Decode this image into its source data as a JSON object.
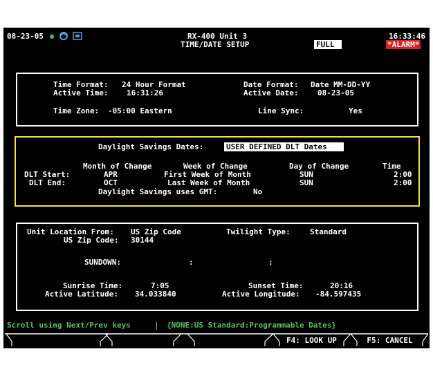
{
  "header": {
    "date": "08-23-05",
    "unit": "RX-400 Unit 3",
    "screen_title": "TIME/DATE SETUP",
    "mode_badge": "FULL",
    "time": "16:33:46",
    "alarm": "*ALARM*"
  },
  "time_section": {
    "time_format_label": "Time Format:",
    "time_format_value": "24 Hour Format",
    "active_time_label": "Active Time:",
    "active_time_value": "16:31:26",
    "date_format_label": "Date Format:",
    "date_format_value": "Date MM-DD-YY",
    "active_date_label": "Active Date:",
    "active_date_value": "08-23-05",
    "time_zone_label": "Time Zone:",
    "time_zone_value": "-05:00 Eastern",
    "line_sync_label": "Line Sync:",
    "line_sync_value": "Yes"
  },
  "dst_section": {
    "dates_label": "Daylight Savings Dates:",
    "dates_value": "USER DEFINED DLT Dates",
    "columns": [
      "Month of Change",
      "Week of Change",
      "Day of Change",
      "Time"
    ],
    "rows": [
      {
        "label": "DLT Start:",
        "month": "APR",
        "week": "First Week of Month",
        "day": "SUN",
        "time": "2:00"
      },
      {
        "label": "DLT End:",
        "month": "OCT",
        "week": "Last Week of Month",
        "day": "SUN",
        "time": "2:00"
      }
    ],
    "gmt_label": "Daylight Savings uses GMT:",
    "gmt_value": "No"
  },
  "location_section": {
    "unit_location_label": "Unit Location From:",
    "unit_location_value": "US Zip Code",
    "twilight_label": "Twilight Type:",
    "twilight_value": "Standard",
    "zip_label": "US Zip Code:",
    "zip_value": "30144",
    "sundown_label": "SUNDOWN:",
    "sundown_sep1": ":",
    "sundown_sep2": ":",
    "sunrise_label": "Sunrise Time:",
    "sunrise_value": "7:05",
    "sunset_label": "Sunset Time:",
    "sunset_value": "20:16",
    "latitude_label": "Active Latitude:",
    "latitude_value": "34.033840",
    "longitude_label": "Active Longitude:",
    "longitude_value": "-84.597435"
  },
  "status_bar": {
    "hint": "Scroll using Next/Prev keys",
    "options": "{NONE:US Standard:Programmable Dates}"
  },
  "function_keys": [
    "",
    "",
    "",
    "",
    "F4: LOOK UP",
    "F5: CANCEL"
  ],
  "colors": {
    "background": "#000000",
    "text": "#ffffff",
    "dst_border": "#f2e14c",
    "status_text": "#58c060",
    "alarm_bg": "#e02020"
  },
  "icons": [
    "status-dot-icon",
    "network-icon",
    "card-icon"
  ]
}
